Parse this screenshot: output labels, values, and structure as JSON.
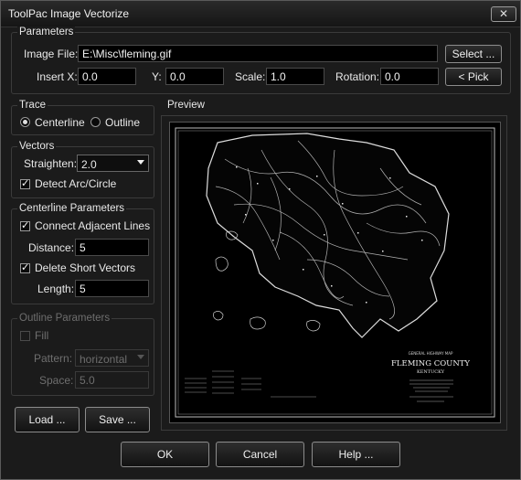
{
  "window": {
    "title": "ToolPac Image Vectorize",
    "close_icon": "close-icon"
  },
  "parameters": {
    "label": "Parameters",
    "image_file_label": "Image File:",
    "image_file_value": "E:\\Misc\\fleming.gif",
    "insert_x_label": "Insert X:",
    "insert_x_value": "0.0",
    "y_label": "Y:",
    "y_value": "0.0",
    "scale_label": "Scale:",
    "scale_value": "1.0",
    "rotation_label": "Rotation:",
    "rotation_value": "0.0",
    "select_button": "Select ...",
    "pick_button": "< Pick"
  },
  "trace": {
    "label": "Trace",
    "centerline_label": "Centerline",
    "outline_label": "Outline",
    "selected": "Centerline"
  },
  "vectors": {
    "label": "Vectors",
    "straighten_label": "Straighten:",
    "straighten_value": "2.0",
    "detect_arc_label": "Detect Arc/Circle",
    "detect_arc_checked": true
  },
  "centerline_params": {
    "label": "Centerline Parameters",
    "connect_label": "Connect Adjacent Lines",
    "connect_checked": true,
    "distance_label": "Distance:",
    "distance_value": "5",
    "delete_short_label": "Delete Short Vectors",
    "delete_short_checked": true,
    "length_label": "Length:",
    "length_value": "5"
  },
  "outline_params": {
    "label": "Outline Parameters",
    "fill_label": "Fill",
    "fill_checked": false,
    "pattern_label": "Pattern:",
    "pattern_value": "horizontal",
    "space_label": "Space:",
    "space_value": "5.0"
  },
  "preview": {
    "label": "Preview",
    "map_title": "FLEMING COUNTY",
    "map_subtitle": "KENTUCKY"
  },
  "footer": {
    "load_button": "Load ...",
    "save_button": "Save ...",
    "ok_button": "OK",
    "cancel_button": "Cancel",
    "help_button": "Help ..."
  }
}
